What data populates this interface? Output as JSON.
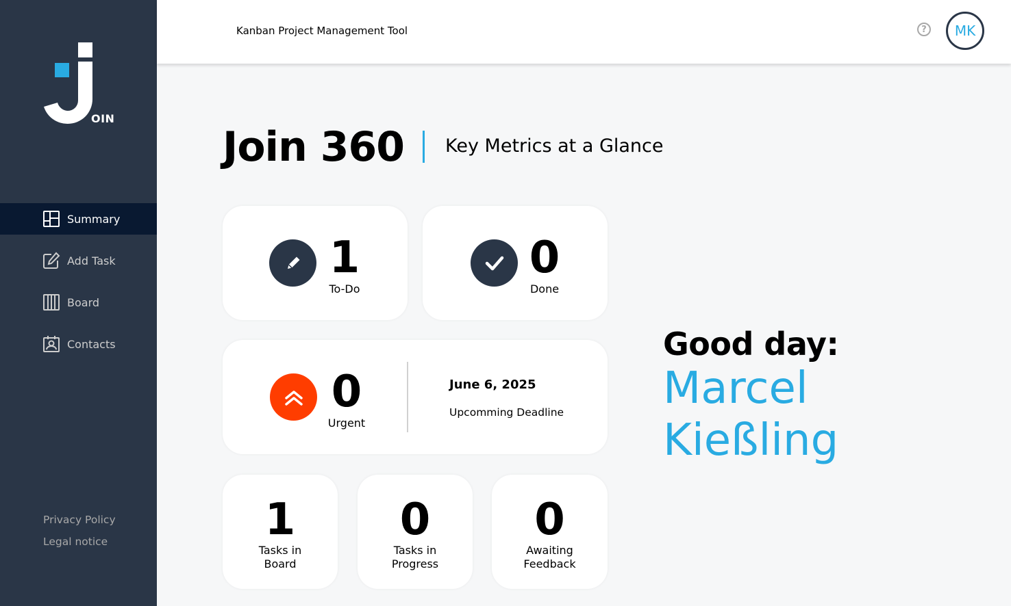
{
  "app": {
    "logo_text": "OIN",
    "header_title": "Kanban Project Management Tool",
    "help_symbol": "?",
    "user_initials": "MK"
  },
  "sidebar": {
    "items": [
      {
        "label": "Summary",
        "icon": "summary-icon",
        "active": true
      },
      {
        "label": "Add Task",
        "icon": "add-task-icon",
        "active": false
      },
      {
        "label": "Board",
        "icon": "board-icon",
        "active": false
      },
      {
        "label": "Contacts",
        "icon": "contacts-icon",
        "active": false
      }
    ],
    "legal": [
      "Privacy Policy",
      "Legal notice"
    ]
  },
  "page": {
    "title": "Join 360",
    "subtitle": "Key Metrics at a Glance"
  },
  "metrics": {
    "todo": {
      "value": "1",
      "label": "To-Do"
    },
    "done": {
      "value": "0",
      "label": "Done"
    },
    "urgent": {
      "value": "0",
      "label": "Urgent"
    },
    "deadline": {
      "date": "June 6, 2025",
      "label": "Upcomming Deadline"
    },
    "board": {
      "value": "1",
      "label_line1": "Tasks in",
      "label_line2": "Board"
    },
    "progress": {
      "value": "0",
      "label_line1": "Tasks in",
      "label_line2": "Progress"
    },
    "feedback": {
      "value": "0",
      "label_line1": "Awaiting",
      "label_line2": "Feedback"
    }
  },
  "greeting": {
    "text": "Good day:",
    "first_name": "Marcel",
    "last_name": "Kießling"
  },
  "colors": {
    "sidebar": "#2a3647",
    "active_nav": "#091931",
    "accent": "#29abe2",
    "urgent": "#ff3d00"
  }
}
